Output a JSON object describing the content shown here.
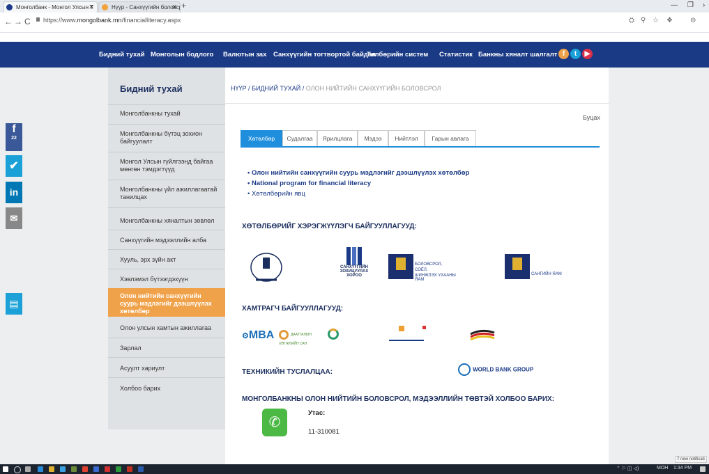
{
  "browser": {
    "tabs": [
      {
        "label": "Монголбанк - Монгол Улсын Т",
        "active": true
      },
      {
        "label": "Нүүр - Санхүүгийн боловсрол",
        "active": false
      }
    ],
    "url_prefix": "https://www.",
    "url_domain": "mongolbank.mn",
    "url_path": "/financialliteracy.aspx"
  },
  "nav": {
    "items": [
      "Бидний тухай",
      "Монголын бодлого",
      "Валютын зах",
      "Санхүүгийн тогтвортой байдал",
      "Төлбөрийн систем",
      "Статистик",
      "Банкны хяналт шалгалт"
    ]
  },
  "social_side": {
    "fb_count": "22"
  },
  "sidebar": {
    "title": "Бидний тухай",
    "items": [
      "Монголбанкны тухай",
      "Монголбанкны бүтэц зохион байгуулалт",
      "Монгол Улсын гүйлгээнд байгаа мөнгөн тэмдэгтүүд",
      "Монголбанкны үйл ажиллагаатай танилцах",
      "Монголбанкны хяналтын зөвлөл",
      "Санхүүгийн мэдээллийн алба",
      "Хууль, эрх зүйн акт",
      "Хэвлэмэл бүтээгдэхүүн",
      "Олон нийтийн санхүүгийн суурь мэдлэгийг дээшлүүлэх хөтөлбөр",
      "Олон улсын хамтын ажиллагаа",
      "Зарлал",
      "Асуулт хариулт",
      "Холбоо барих"
    ]
  },
  "breadcrumb": {
    "home": "НҮҮР",
    "sep": "/",
    "parent": "БИДНИЙ ТУХАЙ",
    "current": "ОЛОН НИЙТИЙН САНХҮҮГИЙН БОЛОВСРОЛ"
  },
  "back_label": "Буцах",
  "content_tabs": [
    "Хөтөлбөр",
    "Судалгаа",
    "Ярилцлага",
    "Мэдээ",
    "Нийтлэл",
    "Гарын авлага"
  ],
  "bullets": [
    "Олон нийтийн санхүүгийн суурь мэдлэгийг дээшлүүлэх хөтөлбөр",
    "National program for financial literacy",
    "Хөтөлбөрийн явц"
  ],
  "sections": {
    "implementers": "ХӨТӨЛБӨРИЙГ ХЭРЭГЖҮҮЛЭГЧ БАЙГУУЛЛАГУУД:",
    "partners": "ХАМТРАГЧ БАЙГУУЛЛАГУУД:",
    "technical": "ТЕХНИКИЙН ТУСЛАЛЦАА:",
    "contact": "МОНГОЛБАНКНЫ ОЛОН НИЙТИЙН БОЛОВСРОЛ, МЭДЭЭЛЛИЙН ТӨВТЭЙ ХОЛБОО БАРИХ:"
  },
  "logos": {
    "frc_1": "САНХҮҮГИЙН",
    "frc_2": "ЗОХИЦУУЛАХ ХОРОО",
    "mes_1": "БОЛОВСРОЛ,",
    "mes_2": "СОЁЛ,",
    "mes_3": "ШИНЖЛЭХ УХААНЫ ЯАМ",
    "mof": "САНГИЙН ЯАМ",
    "mba": "MBA",
    "dic_1": "ДААТГАЛЫН ХӨГЖЛИЙН САН",
    "wb": "WORLD BANK GROUP"
  },
  "contact": {
    "phone_label": "Утас:",
    "phone_number": "11-310081"
  },
  "taskbar": {
    "lang": "МОН",
    "time": "1:34 PM",
    "notification": "7 new notificati"
  }
}
